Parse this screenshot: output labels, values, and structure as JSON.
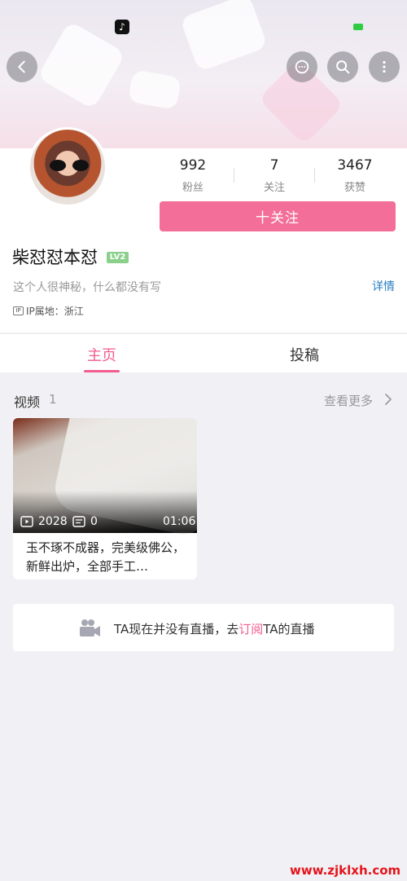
{
  "stats": [
    {
      "num": "992",
      "label": "粉丝"
    },
    {
      "num": "7",
      "label": "关注"
    },
    {
      "num": "3467",
      "label": "获赞"
    }
  ],
  "follow_label": "十关注",
  "user": {
    "name": "柴怼怼本怼",
    "level": "LV2",
    "bio": "这个人很神秘，什么都没有写",
    "detail": "详情",
    "ip_badge": "IP",
    "ip_location": "IP属地：浙江"
  },
  "tabs": [
    {
      "label": "主页",
      "active": true
    },
    {
      "label": "投稿",
      "active": false
    }
  ],
  "videos_section": {
    "title": "视频",
    "count": "1",
    "more": "查看更多"
  },
  "video": {
    "plays": "2028",
    "comments": "0",
    "duration": "01:06",
    "title": "玉不琢不成器，完美级佛公，新鲜出炉，全部手工…"
  },
  "live": {
    "prefix": "TA现在并没有直播，去",
    "link": "订阅",
    "suffix": "TA的直播"
  },
  "watermark": "www.zjklxh.com",
  "icons": [
    "back-icon",
    "chat-icon",
    "search-icon",
    "more-icon",
    "play-count-icon",
    "comment-icon",
    "chevron-right-icon",
    "camera-icon",
    "tiktok-icon"
  ],
  "colors": {
    "accent": "#f46e9a",
    "link_blue": "#2a7fc4",
    "level_green": "#8ad08b"
  }
}
